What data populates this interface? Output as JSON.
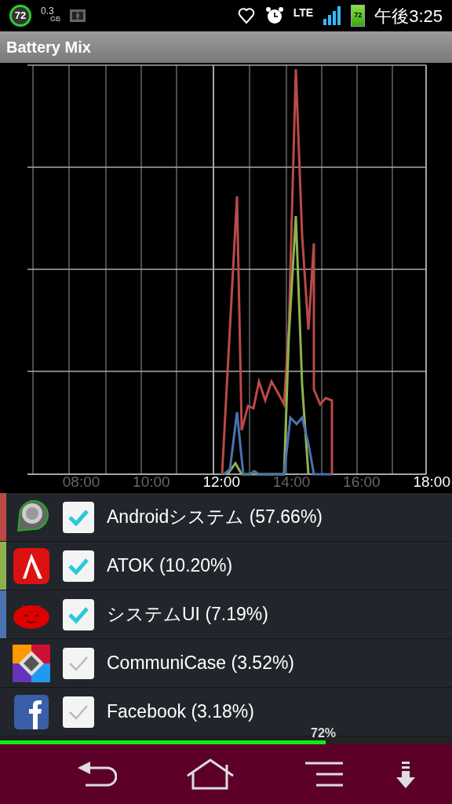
{
  "status_bar": {
    "ring_badge": "72",
    "memory": "0.3",
    "memory_unit": "GB",
    "network": "LTE",
    "battery": "72",
    "time": "午後3:25"
  },
  "title_bar": {
    "title": "Battery Mix"
  },
  "chart": {
    "x_labels": [
      {
        "label": "08:00",
        "highlighted": false
      },
      {
        "label": "10:00",
        "highlighted": false
      },
      {
        "label": "12:00",
        "highlighted": true
      },
      {
        "label": "14:00",
        "highlighted": false
      },
      {
        "label": "16:00",
        "highlighted": false
      },
      {
        "label": "18:00",
        "highlighted": true
      }
    ]
  },
  "apps": [
    {
      "kind": "android",
      "label": "Androidシステム (57.66%)",
      "checked": true,
      "color": "#b94a48"
    },
    {
      "kind": "atok",
      "label": "ATOK (10.20%)",
      "checked": true,
      "color": "#8fb24f"
    },
    {
      "kind": "jellybean",
      "label": "システムUI (7.19%)",
      "checked": true,
      "color": "#4a72b0"
    },
    {
      "kind": "communicase",
      "label": "CommuniCase (3.52%)",
      "checked": false
    },
    {
      "kind": "facebook",
      "label": "Facebook (3.18%)",
      "checked": false
    }
  ],
  "battery_bar": {
    "level": 0.72,
    "reading": "72%"
  }
}
